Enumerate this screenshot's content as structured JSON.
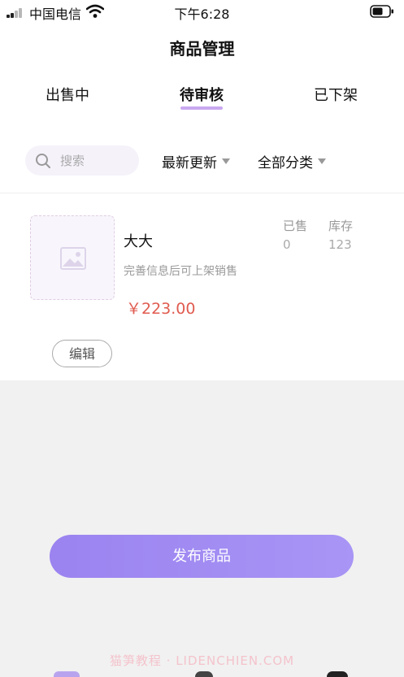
{
  "status_bar": {
    "carrier": "中国电信",
    "time": "下午6:28",
    "icons": [
      "signal-icon",
      "wifi-icon",
      "battery-icon"
    ]
  },
  "header": {
    "title": "商品管理"
  },
  "tabs": [
    {
      "label": "出售中",
      "active": false
    },
    {
      "label": "待审核",
      "active": true
    },
    {
      "label": "已下架",
      "active": false
    }
  ],
  "filters": {
    "search_placeholder": "搜索",
    "sort_label": "最新更新",
    "category_label": "全部分类"
  },
  "product": {
    "name": "大大",
    "hint": "完善信息后可上架销售",
    "price": "￥223.00",
    "sold_label": "已售",
    "sold_value": "0",
    "stock_label": "库存",
    "stock_value": "123",
    "edit_label": "编辑",
    "thumbnail_icon": "image-placeholder-icon"
  },
  "publish_label": "发布商品",
  "watermark": "猫笋教程 · LIDENCHIEN.COM",
  "colors": {
    "accent": "#a08af2",
    "price": "#e05b4f",
    "tab_indicator": "#c9a8f0"
  }
}
